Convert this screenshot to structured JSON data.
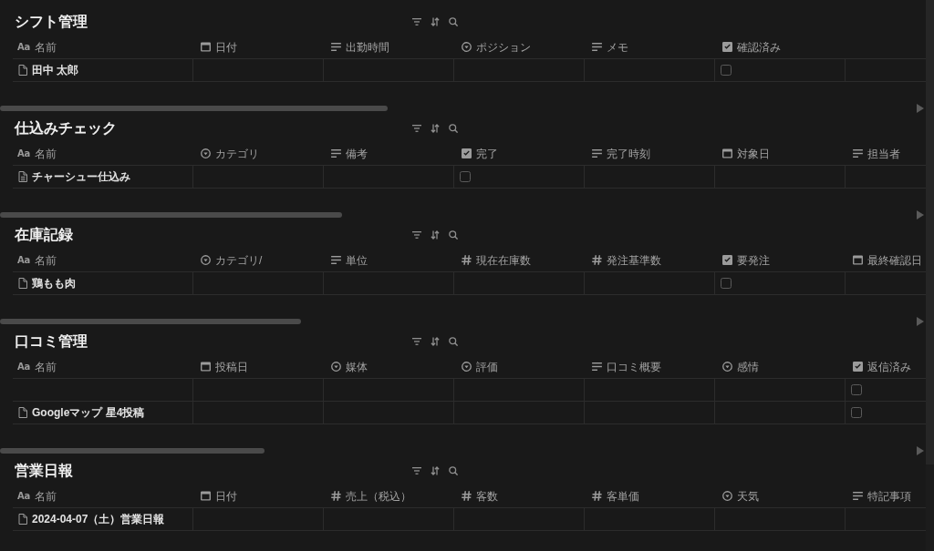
{
  "databases": [
    {
      "title": "シフト管理",
      "columns": [
        {
          "label": "名前",
          "kind": "title",
          "glyph": "Aa"
        },
        {
          "label": "日付",
          "kind": "date"
        },
        {
          "label": "出勤時間",
          "kind": "text"
        },
        {
          "label": "ポジション",
          "kind": "select"
        },
        {
          "label": "メモ",
          "kind": "text"
        },
        {
          "label": "確認済み",
          "kind": "checkbox"
        }
      ],
      "rows": [
        {
          "title": "田中 太郎",
          "page_has_content": false,
          "checked": false
        }
      ]
    },
    {
      "title": "仕込みチェック",
      "columns": [
        {
          "label": "名前",
          "kind": "title",
          "glyph": "Aa"
        },
        {
          "label": "カテゴリ",
          "kind": "select"
        },
        {
          "label": "備考",
          "kind": "text"
        },
        {
          "label": "完了",
          "kind": "checkbox"
        },
        {
          "label": "完了時刻",
          "kind": "text"
        },
        {
          "label": "対象日",
          "kind": "date"
        },
        {
          "label": "担当者",
          "kind": "text"
        }
      ],
      "rows": [
        {
          "title": "チャーシュー仕込み",
          "page_has_content": true,
          "checked": false
        }
      ]
    },
    {
      "title": "在庫記録",
      "columns": [
        {
          "label": "名前",
          "kind": "title",
          "glyph": "Aa"
        },
        {
          "label": "カテゴリ/",
          "kind": "select"
        },
        {
          "label": "単位",
          "kind": "text"
        },
        {
          "label": "現在在庫数",
          "kind": "number"
        },
        {
          "label": "発注基準数",
          "kind": "number"
        },
        {
          "label": "要発注",
          "kind": "checkbox"
        },
        {
          "label": "最終確認日",
          "kind": "date"
        }
      ],
      "rows": [
        {
          "title": "鶏もも肉",
          "page_has_content": false,
          "checked": false
        }
      ]
    },
    {
      "title": "口コミ管理",
      "columns": [
        {
          "label": "名前",
          "kind": "title",
          "glyph": "Aa"
        },
        {
          "label": "投稿日",
          "kind": "date"
        },
        {
          "label": "媒体",
          "kind": "select"
        },
        {
          "label": "評価",
          "kind": "select"
        },
        {
          "label": "口コミ概要",
          "kind": "text"
        },
        {
          "label": "感情",
          "kind": "select"
        },
        {
          "label": "返信済み",
          "kind": "checkbox"
        }
      ],
      "rows": [
        {
          "checked": false
        },
        {
          "title": "Googleマップ 星4投稿",
          "page_has_content": false,
          "checked": false
        }
      ]
    },
    {
      "title": "営業日報",
      "columns": [
        {
          "label": "名前",
          "kind": "title",
          "glyph": "Aa"
        },
        {
          "label": "日付",
          "kind": "date"
        },
        {
          "label": "売上（税込）",
          "kind": "number"
        },
        {
          "label": "客数",
          "kind": "number"
        },
        {
          "label": "客単価",
          "kind": "number"
        },
        {
          "label": "天気",
          "kind": "select"
        },
        {
          "label": "特記事項",
          "kind": "text"
        }
      ],
      "rows": [
        {
          "title": "2024-04-07（土）営業日報",
          "page_has_content": false
        }
      ]
    }
  ]
}
